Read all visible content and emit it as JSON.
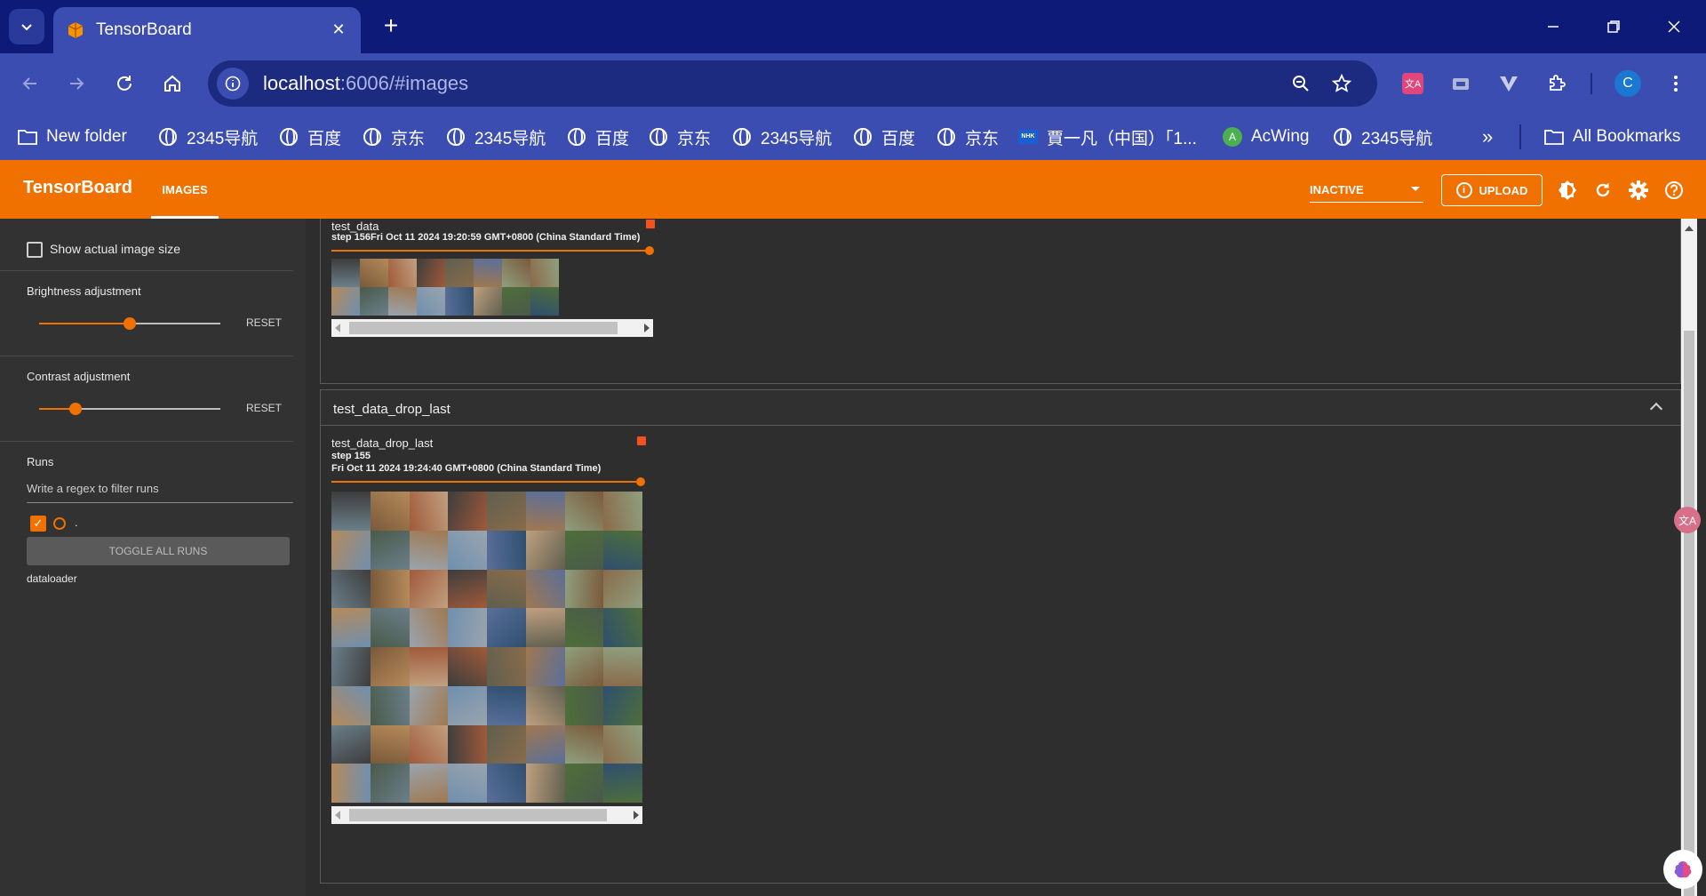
{
  "browser": {
    "tab_title": "TensorBoard",
    "url_host": "localhost",
    "url_rest": ":6006/#images",
    "profile_initial": "C",
    "bookmarks": [
      {
        "label": "New folder",
        "icon": "folder-icon"
      },
      {
        "label": "2345导航",
        "icon": "globe-icon"
      },
      {
        "label": "百度",
        "icon": "globe-icon"
      },
      {
        "label": "京东",
        "icon": "globe-icon"
      },
      {
        "label": "2345导航",
        "icon": "globe-icon"
      },
      {
        "label": "百度",
        "icon": "globe-icon"
      },
      {
        "label": "京东",
        "icon": "globe-icon"
      },
      {
        "label": "2345导航",
        "icon": "globe-icon"
      },
      {
        "label": "百度",
        "icon": "globe-icon"
      },
      {
        "label": "京东",
        "icon": "globe-icon"
      },
      {
        "label": "賈一凡（中国）「1...",
        "icon": "nhk-icon"
      },
      {
        "label": "AcWing",
        "icon": "acwing-icon"
      },
      {
        "label": "2345导航",
        "icon": "globe-icon"
      }
    ],
    "more_bookmarks": "»",
    "all_bookmarks": "All Bookmarks"
  },
  "tensorboard": {
    "logo": "TensorBoard",
    "active_tab": "IMAGES",
    "status_select": "INACTIVE",
    "upload_label": "UPLOAD"
  },
  "sidebar": {
    "show_actual_size": "Show actual image size",
    "brightness_label": "Brightness adjustment",
    "brightness_value": 0.5,
    "contrast_label": "Contrast adjustment",
    "contrast_value": 0.2,
    "reset_label": "RESET",
    "runs_label": "Runs",
    "filter_placeholder": "Write a regex to filter runs",
    "run_item": ".",
    "toggle_all": "TOGGLE ALL RUNS",
    "run_group": "dataloader"
  },
  "main": {
    "card1": {
      "title": "test_data",
      "step_label": "step",
      "step_value": "156",
      "timestamp": "Fri Oct 11 2024 19:20:59 GMT+0800 (China Standard Time)"
    },
    "group2_title": "test_data_drop_last",
    "card2": {
      "title": "test_data_drop_last",
      "step_label": "step",
      "step_value": "155",
      "timestamp": "Fri Oct 11 2024 19:24:40 GMT+0800 (China Standard Time)"
    }
  },
  "colors": {
    "accent": "#f07000",
    "browser_frame": "#0d1a78",
    "browser_toolbar": "#3b4db0"
  }
}
